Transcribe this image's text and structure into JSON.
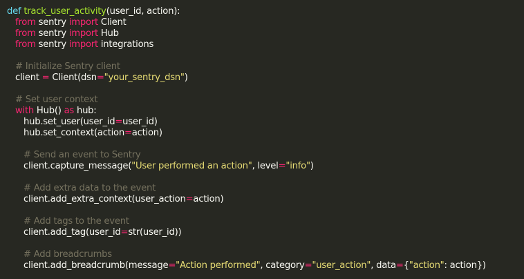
{
  "code_lines": [
    {
      "indent": 0,
      "tokens": [
        {
          "t": "def",
          "c": "def"
        },
        {
          "t": " ",
          "c": "plain"
        },
        {
          "t": "track_user_activity",
          "c": "fn"
        },
        {
          "t": "(user_id, action):",
          "c": "plain"
        }
      ]
    },
    {
      "indent": 1,
      "tokens": [
        {
          "t": "from",
          "c": "kw"
        },
        {
          "t": " sentry ",
          "c": "plain"
        },
        {
          "t": "import",
          "c": "kw"
        },
        {
          "t": " Client",
          "c": "plain"
        }
      ]
    },
    {
      "indent": 1,
      "tokens": [
        {
          "t": "from",
          "c": "kw"
        },
        {
          "t": " sentry ",
          "c": "plain"
        },
        {
          "t": "import",
          "c": "kw"
        },
        {
          "t": " Hub",
          "c": "plain"
        }
      ]
    },
    {
      "indent": 1,
      "tokens": [
        {
          "t": "from",
          "c": "kw"
        },
        {
          "t": " sentry ",
          "c": "plain"
        },
        {
          "t": "import",
          "c": "kw"
        },
        {
          "t": " integrations",
          "c": "plain"
        }
      ]
    },
    {
      "indent": 1,
      "blank": true,
      "tokens": []
    },
    {
      "indent": 1,
      "tokens": [
        {
          "t": "# Initialize Sentry client",
          "c": "com"
        }
      ]
    },
    {
      "indent": 1,
      "tokens": [
        {
          "t": "client ",
          "c": "plain"
        },
        {
          "t": "=",
          "c": "op"
        },
        {
          "t": " Client(dsn",
          "c": "plain"
        },
        {
          "t": "=",
          "c": "op"
        },
        {
          "t": "\"your_sentry_dsn\"",
          "c": "str"
        },
        {
          "t": ")",
          "c": "plain"
        }
      ]
    },
    {
      "indent": 1,
      "blank": true,
      "tokens": []
    },
    {
      "indent": 1,
      "tokens": [
        {
          "t": "# Set user context",
          "c": "com"
        }
      ]
    },
    {
      "indent": 1,
      "tokens": [
        {
          "t": "with",
          "c": "kw"
        },
        {
          "t": " Hub() ",
          "c": "plain"
        },
        {
          "t": "as",
          "c": "kw"
        },
        {
          "t": " hub:",
          "c": "plain"
        }
      ]
    },
    {
      "indent": 2,
      "tokens": [
        {
          "t": "hub.set_user(user_id",
          "c": "plain"
        },
        {
          "t": "=",
          "c": "op"
        },
        {
          "t": "user_id)",
          "c": "plain"
        }
      ]
    },
    {
      "indent": 2,
      "tokens": [
        {
          "t": "hub.set_context(action",
          "c": "plain"
        },
        {
          "t": "=",
          "c": "op"
        },
        {
          "t": "action)",
          "c": "plain"
        }
      ]
    },
    {
      "indent": 2,
      "blank": true,
      "tokens": []
    },
    {
      "indent": 2,
      "tokens": [
        {
          "t": "# Send an event to Sentry",
          "c": "com"
        }
      ]
    },
    {
      "indent": 2,
      "tokens": [
        {
          "t": "client.capture_message(",
          "c": "plain"
        },
        {
          "t": "\"User performed an action\"",
          "c": "str"
        },
        {
          "t": ", level",
          "c": "plain"
        },
        {
          "t": "=",
          "c": "op"
        },
        {
          "t": "\"info\"",
          "c": "str"
        },
        {
          "t": ")",
          "c": "plain"
        }
      ]
    },
    {
      "indent": 2,
      "blank": true,
      "tokens": []
    },
    {
      "indent": 2,
      "tokens": [
        {
          "t": "# Add extra data to the event",
          "c": "com"
        }
      ]
    },
    {
      "indent": 2,
      "tokens": [
        {
          "t": "client.add_extra_context(user_action",
          "c": "plain"
        },
        {
          "t": "=",
          "c": "op"
        },
        {
          "t": "action)",
          "c": "plain"
        }
      ]
    },
    {
      "indent": 2,
      "blank": true,
      "tokens": []
    },
    {
      "indent": 2,
      "tokens": [
        {
          "t": "# Add tags to the event",
          "c": "com"
        }
      ]
    },
    {
      "indent": 2,
      "tokens": [
        {
          "t": "client.add_tag(user_id",
          "c": "plain"
        },
        {
          "t": "=",
          "c": "op"
        },
        {
          "t": "str(user_id))",
          "c": "plain"
        }
      ]
    },
    {
      "indent": 2,
      "blank": true,
      "tokens": []
    },
    {
      "indent": 2,
      "tokens": [
        {
          "t": "# Add breadcrumbs",
          "c": "com"
        }
      ]
    },
    {
      "indent": 2,
      "tokens": [
        {
          "t": "client.add_breadcrumb(message",
          "c": "plain"
        },
        {
          "t": "=",
          "c": "op"
        },
        {
          "t": "\"Action performed\"",
          "c": "str"
        },
        {
          "t": ", category",
          "c": "plain"
        },
        {
          "t": "=",
          "c": "op"
        },
        {
          "t": "\"user_action\"",
          "c": "str"
        },
        {
          "t": ", data",
          "c": "plain"
        },
        {
          "t": "=",
          "c": "op"
        },
        {
          "t": "{",
          "c": "plain"
        },
        {
          "t": "\"action\"",
          "c": "str"
        },
        {
          "t": ": action})",
          "c": "plain"
        }
      ]
    }
  ],
  "theme": {
    "background": "#272822",
    "keyword": "#f92672",
    "def_keyword": "#66d9ef",
    "function_name": "#a6e22e",
    "string": "#e6db74",
    "comment": "#75715e",
    "text": "#f8f8f2"
  }
}
